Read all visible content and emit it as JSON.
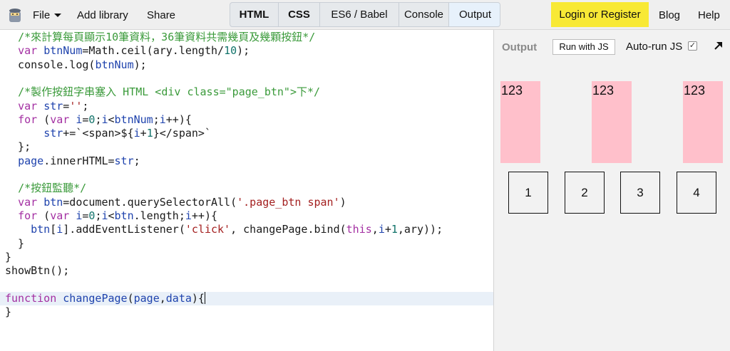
{
  "topbar": {
    "menu": {
      "file": "File",
      "add_library": "Add library",
      "share": "Share"
    },
    "tabs": [
      "HTML",
      "CSS",
      "ES6 / Babel",
      "Console",
      "Output"
    ],
    "login": "Login or Register",
    "blog": "Blog",
    "help": "Help"
  },
  "output": {
    "label": "Output",
    "run_button": "Run with JS",
    "autorun_label": "Auto-run JS",
    "autorun_checked": "✓",
    "boxes": [
      "123",
      "123",
      "123"
    ],
    "buttons": [
      "1",
      "2",
      "3",
      "4"
    ]
  }
}
